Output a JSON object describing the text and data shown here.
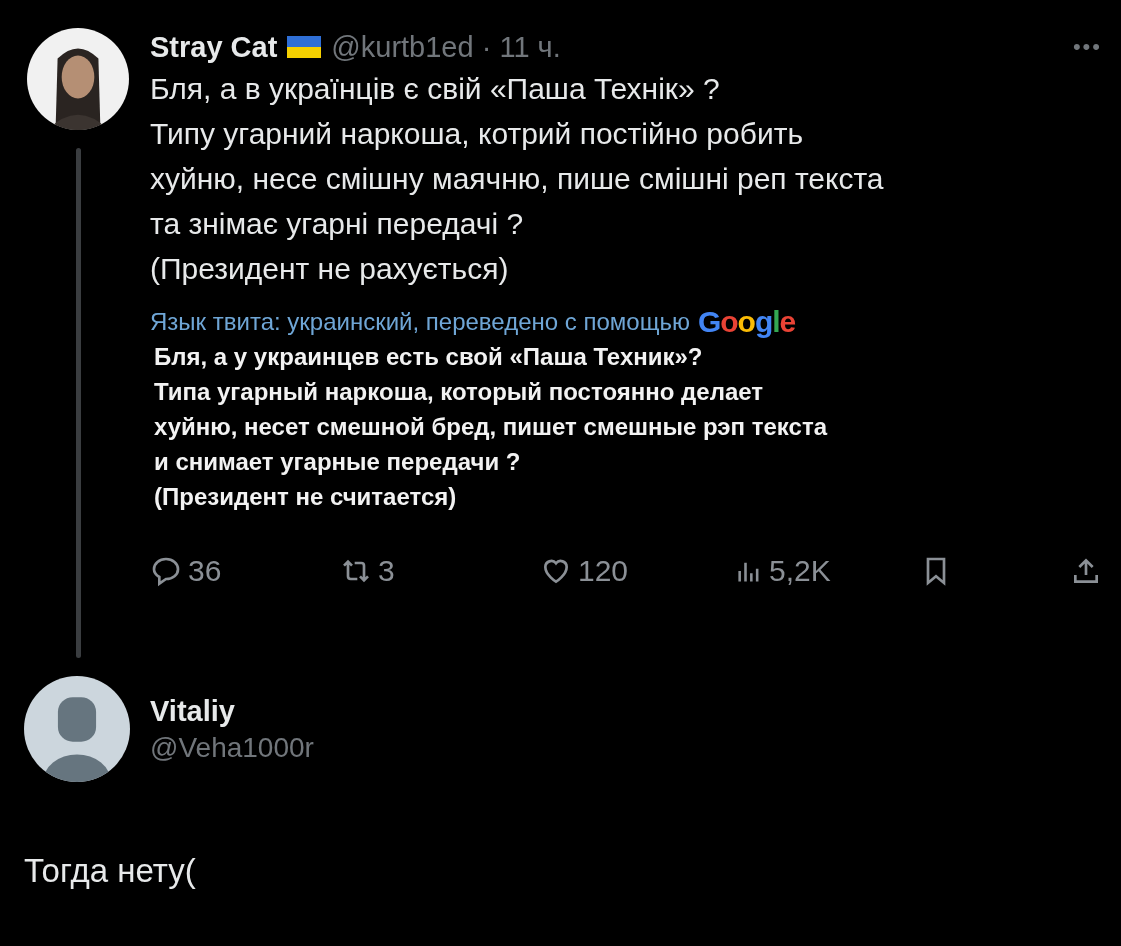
{
  "tweet": {
    "author": {
      "name": "Stray Cat",
      "handle": "@kurtb1ed",
      "time": "· 11 ч."
    },
    "more": "•••",
    "lines": [
      "Бля, а в українців є свій «Паша Технік» ?",
      "Типу угарний наркоша, котрий постійно робить",
      "хуйню, несе смішну маячню, пише смішні реп текста",
      "та знімає угарні передачі ?",
      "(Президент не рахується)"
    ],
    "translation_note": "Язык твита: украинский, переведено с помощью",
    "translation_brand": "Google",
    "translation_lines": [
      "Бля, а у украинцев есть свой «Паша Техник»?",
      "Типа угарный наркоша, который постоянно делает",
      "хуйню, несет смешной бред, пишет смешные рэп текста",
      "и снимает угарные передачи ?",
      "(Президент не считается)"
    ],
    "actions": [
      {
        "kind": "reply",
        "count": "36"
      },
      {
        "kind": "repost",
        "count": "3"
      },
      {
        "kind": "like",
        "count": "120"
      },
      {
        "kind": "views",
        "count": "5,2K"
      },
      {
        "kind": "bookmark"
      },
      {
        "kind": "share"
      }
    ]
  },
  "reply": {
    "name": "Vitaliy",
    "handle": "@Veha1000r",
    "text": "Тогда нету("
  }
}
